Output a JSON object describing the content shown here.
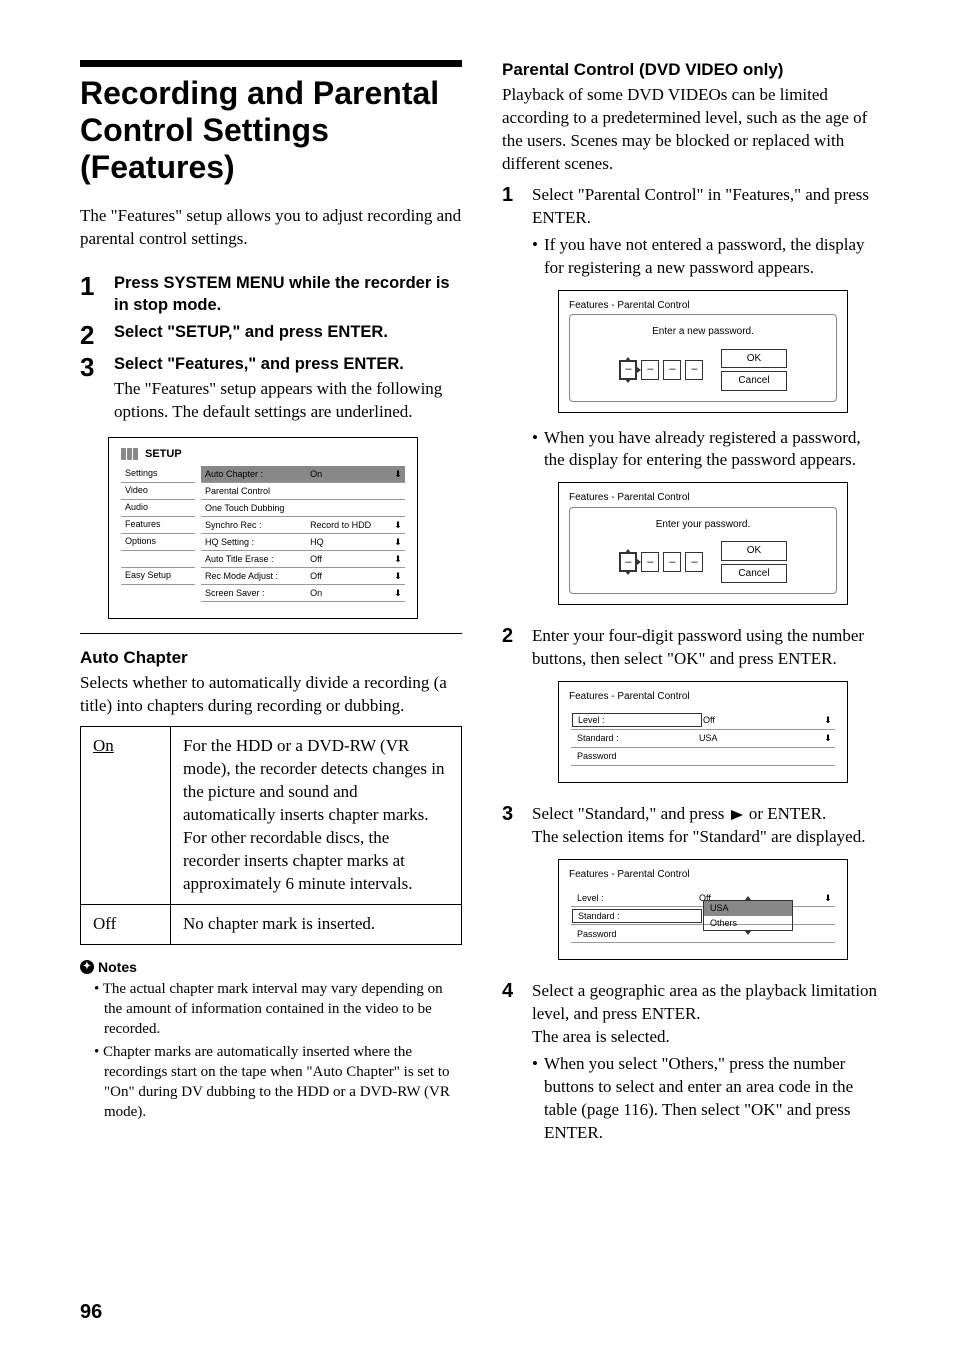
{
  "page_number": "96",
  "left": {
    "title": "Recording and Parental Control Settings (Features)",
    "intro": "The \"Features\" setup allows you to adjust recording and parental control settings.",
    "steps": [
      {
        "num": "1",
        "head": "Press SYSTEM MENU while the recorder is in stop mode."
      },
      {
        "num": "2",
        "head": "Select \"SETUP,\" and press ENTER."
      },
      {
        "num": "3",
        "head": "Select \"Features,\" and press ENTER.",
        "desc": "The \"Features\" setup appears with the following options. The default settings are underlined."
      }
    ],
    "setup": {
      "title": "SETUP",
      "left_items": [
        "Settings",
        "Video",
        "Audio",
        "Features",
        "Options",
        "",
        "Easy Setup"
      ],
      "rows": [
        {
          "label": "Auto Chapter :",
          "value": "On",
          "hi": true,
          "arrow": "⬇"
        },
        {
          "label": "Parental Control",
          "value": "",
          "arrow": ""
        },
        {
          "label": "One Touch Dubbing",
          "value": "",
          "arrow": ""
        },
        {
          "label": "Synchro Rec :",
          "value": "Record to HDD",
          "arrow": "⬇"
        },
        {
          "label": "HQ Setting :",
          "value": "HQ",
          "arrow": "⬇"
        },
        {
          "label": "Auto Title Erase :",
          "value": "Off",
          "arrow": "⬇"
        },
        {
          "label": "Rec Mode  Adjust :",
          "value": "Off",
          "arrow": "⬇"
        },
        {
          "label": "Screen Saver :",
          "value": "On",
          "arrow": "⬇"
        }
      ]
    },
    "auto_chapter": {
      "heading": "Auto Chapter",
      "desc": "Selects whether to automatically divide a recording (a title) into chapters during recording or dubbing.",
      "opts": [
        {
          "name": "On",
          "text": "For the HDD or a DVD-RW (VR mode), the recorder detects changes in the picture and sound and automatically inserts chapter marks.\nFor other recordable discs, the recorder inserts chapter marks at approximately 6 minute intervals."
        },
        {
          "name": "Off",
          "text": "No chapter mark is inserted."
        }
      ]
    },
    "notes_heading": "Notes",
    "notes": [
      "The actual chapter mark interval may vary depending on the amount of information contained in the video to be recorded.",
      "Chapter marks are automatically inserted where the recordings start on the tape when \"Auto Chapter\" is set to \"On\" during DV dubbing to the HDD or a DVD-RW (VR mode)."
    ]
  },
  "right": {
    "pc_heading": "Parental Control (DVD VIDEO only)",
    "pc_intro": "Playback of some DVD VIDEOs can be limited according to a predetermined level, such as the age of the users. Scenes may be blocked or replaced with different scenes.",
    "steps": {
      "s1": {
        "num": "1",
        "text": "Select \"Parental Control\" in \"Features,\" and press ENTER.",
        "bullet1": "If you have not entered a password, the display for registering a new password appears.",
        "box1_title": "Features - Parental Control",
        "box1_msg": "Enter a new password.",
        "bullet2": "When you have already registered a password, the display for entering the password appears.",
        "box2_title": "Features - Parental Control",
        "box2_msg": "Enter your password."
      },
      "s2": {
        "num": "2",
        "text": "Enter your four-digit password using the number buttons, then select \"OK\" and press ENTER.",
        "box_title": "Features - Parental Control",
        "rows": [
          {
            "label": "Level :",
            "value": "Off",
            "arrow": "⬇",
            "boxed": true
          },
          {
            "label": "Standard :",
            "value": "USA",
            "arrow": "⬇"
          },
          {
            "label": "Password",
            "value": "",
            "arrow": ""
          }
        ]
      },
      "s3": {
        "num": "3",
        "text_a": "Select \"Standard,\" and press ",
        "text_b": " or ENTER.",
        "desc": "The selection items for \"Standard\" are displayed.",
        "box_title": "Features - Parental Control",
        "rows": [
          {
            "label": "Level :",
            "value": "Off",
            "arrow": "⬇"
          },
          {
            "label": "Standard :",
            "boxed": true
          },
          {
            "label": "Password",
            "value": "",
            "arrow": ""
          }
        ],
        "dropdown": [
          "USA",
          "Others"
        ]
      },
      "s4": {
        "num": "4",
        "text": "Select a geographic area as the playback limitation level, and press ENTER.",
        "desc": "The area is selected.",
        "bullet": "When you select \"Others,\" press the number buttons to select and enter an area code in the table (page 116). Then select \"OK\" and press ENTER."
      }
    },
    "ok": "OK",
    "cancel": "Cancel"
  }
}
